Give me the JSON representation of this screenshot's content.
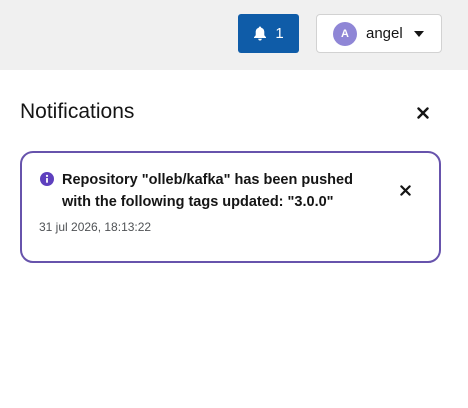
{
  "header": {
    "notifications_count": "1",
    "user": {
      "avatar_letter": "A",
      "name": "angel"
    }
  },
  "panel": {
    "title": "Notifications"
  },
  "notification": {
    "message": "Repository \"olleb/kafka\" has been pushed with the following tags updated: \"3.0.0\"",
    "timestamp": "31 jul 2026, 18:13:22"
  },
  "icons": {
    "bell": "bell-icon",
    "info": "info-icon",
    "close": "close-icon",
    "caret": "caret-down-icon"
  },
  "colors": {
    "primary_button": "#0f5ca8",
    "avatar": "#8f86d6",
    "card_border": "#6753ac",
    "info_icon": "#5e40be",
    "topbar": "#f0f0f0"
  }
}
